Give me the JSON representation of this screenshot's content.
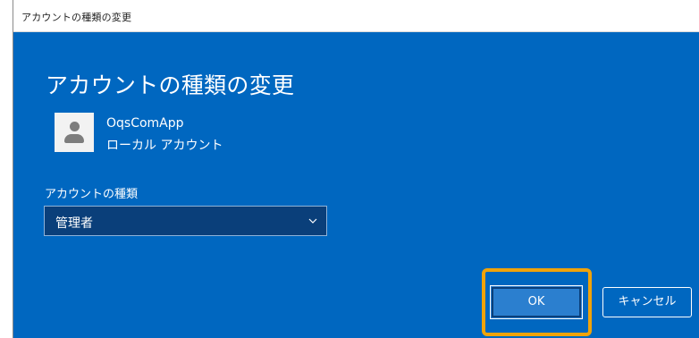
{
  "window": {
    "title": "アカウントの種類の変更"
  },
  "dialog": {
    "heading": "アカウントの種類の変更",
    "user": {
      "name": "OqsComApp",
      "account_kind": "ローカル アカウント",
      "avatar_icon": "person-icon"
    },
    "account_type_label": "アカウントの種類",
    "account_type_select": {
      "selected": "管理者",
      "icon": "chevron-down-icon"
    },
    "buttons": {
      "ok_label": "OK",
      "cancel_label": "キャンセル"
    }
  },
  "colors": {
    "dialog_background": "#0067c0",
    "select_background": "#0a3f7a",
    "highlight_border": "#f0a30a",
    "titlebar_background": "#ffffff"
  }
}
